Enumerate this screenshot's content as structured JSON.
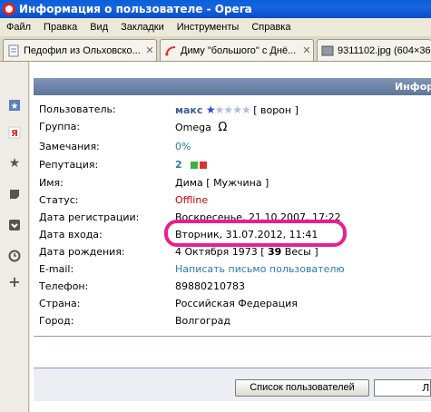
{
  "window": {
    "title": "Информация о пользователе - Opera"
  },
  "menu": [
    "Файл",
    "Правка",
    "Вид",
    "Закладки",
    "Инструменты",
    "Справка"
  ],
  "tabs": [
    {
      "label": "Педофил из Ольховско...",
      "icon": "page-icon"
    },
    {
      "label": "Диму \"большого\" с Днё...",
      "icon": "feed-icon"
    },
    {
      "label": "9311102.jpg (604×36",
      "icon": "image-icon"
    }
  ],
  "panel": {
    "header": "Инфор"
  },
  "profile": {
    "user_label": "Пользователь:",
    "user_name": "макс",
    "user_rank": "[ ворон ]",
    "group_label": "Группа:",
    "group_value": "Omega",
    "group_symbol": "Ω",
    "warnings_label": "Замечания:",
    "warnings_value": "0%",
    "rep_label": "Репутация:",
    "rep_value": "2",
    "name_label": "Имя:",
    "name_value": "Дима [ Мужчина ]",
    "status_label": "Статус:",
    "status_value": "Offline",
    "reg_label": "Дата регистрации:",
    "reg_value": "Воскресенье, 21.10.2007, 17:22",
    "login_label": "Дата входа:",
    "login_value": "Вторник, 31.07.2012, 11:41",
    "birth_label": "Дата рождения:",
    "birth_value_pre": "4 Октября 1973 [",
    "birth_age": "39",
    "birth_sign": "Весы ]",
    "email_label": "E-mail:",
    "email_value": "Написать письмо пользователю",
    "phone_label": "Телефон:",
    "phone_value": "89880210783",
    "country_label": "Страна:",
    "country_value": "Российская Федерация",
    "city_label": "Город:",
    "city_value": "Волгоград"
  },
  "footer": {
    "list_button": "Список пользователей",
    "input_value": "Л"
  },
  "colors": {
    "highlight": "#e8208e",
    "link": "#2a7ab0",
    "offline": "#cc0000",
    "header": "#6a82a6"
  }
}
